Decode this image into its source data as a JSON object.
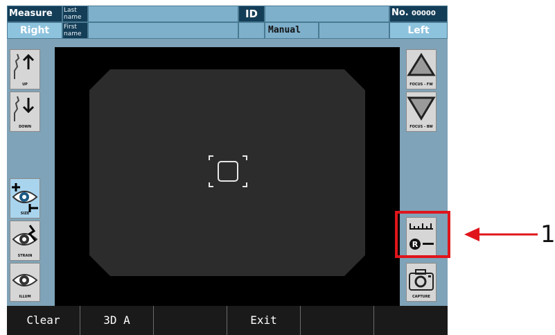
{
  "header": {
    "mode": "Measure",
    "last_name_label": "Last name",
    "first_name_label": "First name",
    "id_label": "ID",
    "no_label": "No.",
    "no_value": "00000",
    "eye_left_side": "Right",
    "capture_mode": "Manual",
    "eye_right_side": "Left"
  },
  "left_panel": [
    {
      "caption": "UP",
      "icon": "chin-up-icon"
    },
    {
      "caption": "DOWN",
      "icon": "chin-down-icon"
    },
    {
      "caption": "SIZE",
      "icon": "eye-size-icon"
    },
    {
      "caption": "STRAIN",
      "icon": "eye-strain-icon"
    },
    {
      "caption": "ILLUM",
      "icon": "eye-illum-icon"
    }
  ],
  "right_panel": [
    {
      "caption": "FOCUS - FW",
      "icon": "focus-forward-icon"
    },
    {
      "caption": "FOCUS - BW",
      "icon": "focus-backward-icon"
    },
    {
      "caption": "",
      "icon": "ruler-measure-icon"
    },
    {
      "caption": "CAPTURE",
      "icon": "camera-icon"
    }
  ],
  "bottom_buttons": [
    "Clear",
    "3D A",
    "",
    "Exit",
    "",
    ""
  ],
  "annotation": {
    "number": "1",
    "color": "#e0151b"
  }
}
